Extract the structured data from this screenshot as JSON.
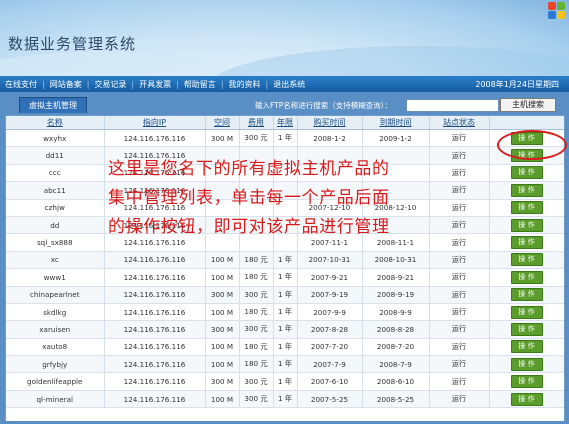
{
  "app": {
    "title": "数据业务管理系统"
  },
  "nav": {
    "items": [
      "在线支付",
      "网站备案",
      "交易记录",
      "开具发票",
      "帮助留言",
      "我的资料",
      "退出系统"
    ],
    "date": "2008年1月24日星期四"
  },
  "tab": {
    "label": "虚拟主机管理"
  },
  "search": {
    "label": "输入FTP名称进行搜索（支持模糊查询）：",
    "value": "",
    "button_label": "主机搜索"
  },
  "table": {
    "columns": [
      "名称",
      "指向IP",
      "空间",
      "费用",
      "年限",
      "购买时间",
      "到期时间",
      "站点状态",
      ""
    ],
    "action_label": "操 作",
    "rows": [
      [
        "wxyhx",
        "124.116.176.116",
        "300 M",
        "300 元",
        "1 年",
        "2008-1-2",
        "2009-1-2",
        "运行"
      ],
      [
        "dd11",
        "124.116.176.116",
        "",
        "",
        "",
        "",
        "",
        "运行"
      ],
      [
        "ccc",
        "124.116.176.116",
        "",
        "",
        "",
        "",
        "",
        "运行"
      ],
      [
        "abc11",
        "124.116.176.116",
        "",
        "",
        "",
        "",
        "",
        "运行"
      ],
      [
        "czhjw",
        "124.116.176.116",
        "",
        "",
        "",
        "2007-12-10",
        "2008-12-10",
        "运行"
      ],
      [
        "dd",
        "124.116.176.116",
        "",
        "",
        "",
        "",
        "",
        "运行"
      ],
      [
        "sql_sx888",
        "124.116.176.116",
        "",
        "",
        "",
        "2007-11-1",
        "2008-11-1",
        "运行"
      ],
      [
        "xc",
        "124.116.176.116",
        "100 M",
        "180 元",
        "1 年",
        "2007-10-31",
        "2008-10-31",
        "运行"
      ],
      [
        "www1",
        "124.116.176.116",
        "100 M",
        "180 元",
        "1 年",
        "2007-9-21",
        "2008-9-21",
        "运行"
      ],
      [
        "chinapearlnet",
        "124.116.176.116",
        "300 M",
        "300 元",
        "1 年",
        "2007-9-19",
        "2008-9-19",
        "运行"
      ],
      [
        "skdlkg",
        "124.116.176.116",
        "100 M",
        "180 元",
        "1 年",
        "2007-9-9",
        "2008-9-9",
        "运行"
      ],
      [
        "xaruisen",
        "124.116.176.116",
        "300 M",
        "300 元",
        "1 年",
        "2007-8-28",
        "2008-8-28",
        "运行"
      ],
      [
        "xauto8",
        "124.116.176.116",
        "100 M",
        "180 元",
        "1 年",
        "2007-7-20",
        "2008-7-20",
        "运行"
      ],
      [
        "grfybjy",
        "124.116.176.116",
        "100 M",
        "180 元",
        "1 年",
        "2007-7-9",
        "2008-7-9",
        "运行"
      ],
      [
        "goldenlifeapple",
        "124.116.176.116",
        "300 M",
        "300 元",
        "1 年",
        "2007-6-10",
        "2008-6-10",
        "运行"
      ],
      [
        "ql-mineral",
        "124.116.176.116",
        "100 M",
        "300 元",
        "1 年",
        "2007-5-25",
        "2008-5-25",
        "运行"
      ]
    ]
  },
  "annotation": {
    "lines": [
      "这里是您名下的所有虚拟主机产品的",
      "集中管理列表，单击每一个产品后面",
      "的操作按钮，即可对该产品进行管理"
    ],
    "color": "#d91a1a"
  },
  "colors": {
    "accent": "#2a7ec8",
    "action_button": "#5a9d2b"
  }
}
